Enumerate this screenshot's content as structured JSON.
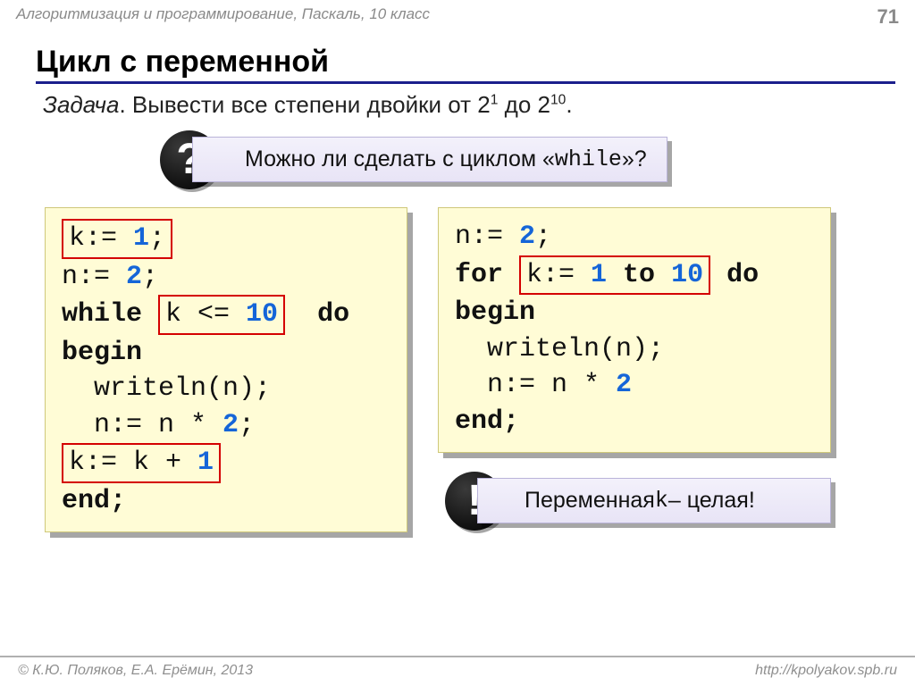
{
  "header": {
    "course": "Алгоритмизация и программирование, Паскаль, 10 класс",
    "page": "71"
  },
  "title": "Цикл с переменной",
  "task": {
    "label": "Задача",
    "text_pre": ". Вывести все степени двойки от 2",
    "sup1": "1",
    "text_mid": " до 2",
    "sup2": "10",
    "text_end": "."
  },
  "question": {
    "badge": "?",
    "text_before": "Можно ли сделать с циклом «",
    "code_word": "while",
    "text_after": "»?"
  },
  "code_left": {
    "l1_a": "k:= ",
    "l1_num": "1",
    "l1_b": ";",
    "l2_a": "n:= ",
    "l2_num": "2",
    "l2_b": ";",
    "l3_while": "while ",
    "l3_box_a": "k <= ",
    "l3_box_num": "10",
    "l3_do": "  do",
    "l4": "begin",
    "l5": "writeln(n);",
    "l6_a": "n:= n * ",
    "l6_num": "2",
    "l6_b": ";",
    "l7_a": "k:= k + ",
    "l7_num": "1",
    "l8": "end;"
  },
  "code_right": {
    "l1_a": "n:= ",
    "l1_num": "2",
    "l1_b": ";",
    "l2_for": "for ",
    "l2_box_a": "k:= ",
    "l2_box_n1": "1",
    "l2_box_to": " to ",
    "l2_box_n2": "10",
    "l2_do": " do",
    "l3": "begin",
    "l4": "writeln(n);",
    "l5_a": "n:= n * ",
    "l5_num": "2",
    "l6": "end;"
  },
  "note": {
    "badge": "!",
    "text_before": "Переменная ",
    "code_word": "k",
    "text_after": " – целая!"
  },
  "footer": {
    "copyright": "© К.Ю. Поляков, Е.А. Ерёмин, 2013",
    "url": "http://kpolyakov.spb.ru"
  }
}
